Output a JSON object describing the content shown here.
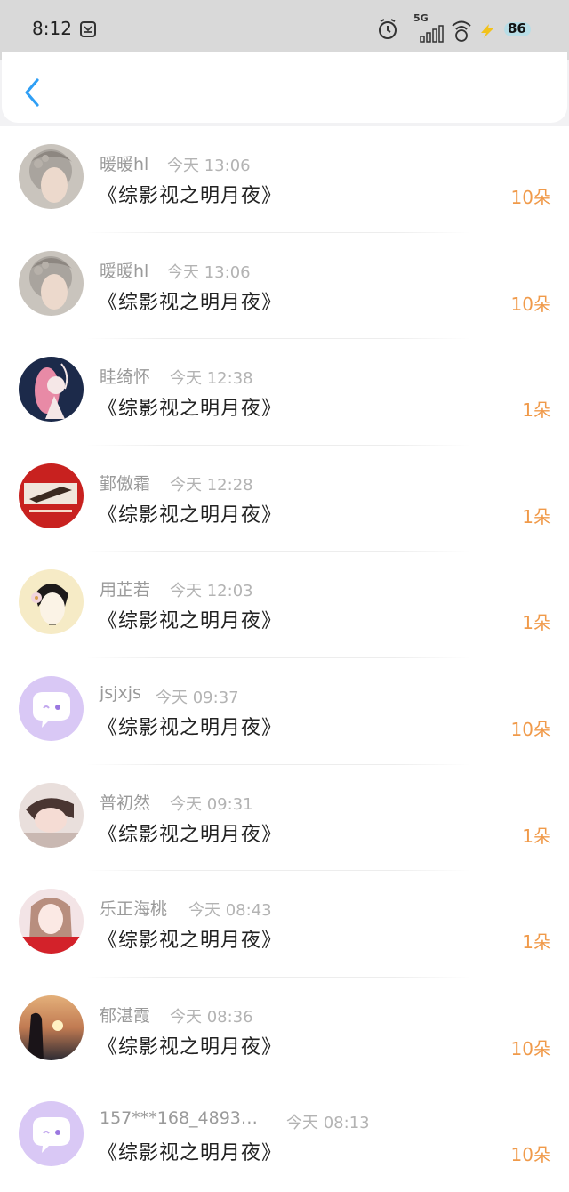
{
  "status_bar": {
    "time": "8:12",
    "network": "5G",
    "battery": "86",
    "icons": [
      "screenshot-icon",
      "alarm-icon",
      "signal-icon",
      "wifi-icon",
      "charging-icon",
      "battery-icon"
    ]
  },
  "nav": {
    "back_icon": "chevron-left-icon"
  },
  "colors": {
    "accent": "#2f9ff5",
    "amount": "#f09a4a",
    "name": "#9a9a9a",
    "time": "#b3b3b3"
  },
  "gifts": [
    {
      "name": "暖暖hl",
      "time": "今天 13:06",
      "book": "《综影视之明月夜》",
      "amount": "10朵",
      "avatar": "braided-hair-portrait"
    },
    {
      "name": "暖暖hl",
      "time": "今天 13:06",
      "book": "《综影视之明月夜》",
      "amount": "10朵",
      "avatar": "braided-hair-portrait"
    },
    {
      "name": "眭绮怀",
      "time": "今天 12:38",
      "book": "《综影视之明月夜》",
      "amount": "1朵",
      "avatar": "navy-illustration"
    },
    {
      "name": "鄞傲霜",
      "time": "今天 12:28",
      "book": "《综影视之明月夜》",
      "amount": "1朵",
      "avatar": "red-poster"
    },
    {
      "name": "用芷若",
      "time": "今天 12:03",
      "book": "《综影视之明月夜》",
      "amount": "1朵",
      "avatar": "lady-with-flower"
    },
    {
      "name": "jsjxjs",
      "time": "今天 09:37",
      "book": "《综影视之明月夜》",
      "amount": "10朵",
      "avatar": "default-chat"
    },
    {
      "name": "普初然",
      "time": "今天 09:31",
      "book": "《综影视之明月夜》",
      "amount": "1朵",
      "avatar": "girl-photo"
    },
    {
      "name": "乐正海桃",
      "time": "今天 08:43",
      "book": "《综影视之明月夜》",
      "amount": "1朵",
      "avatar": "pink-girl"
    },
    {
      "name": "郁湛霞",
      "time": "今天 08:36",
      "book": "《综影视之明月夜》",
      "amount": "10朵",
      "avatar": "sunset-silhouette"
    },
    {
      "name": "157***168_4893…",
      "time": "今天 08:13",
      "book": "《综影视之明月夜》",
      "amount": "10朵",
      "avatar": "default-chat"
    }
  ]
}
